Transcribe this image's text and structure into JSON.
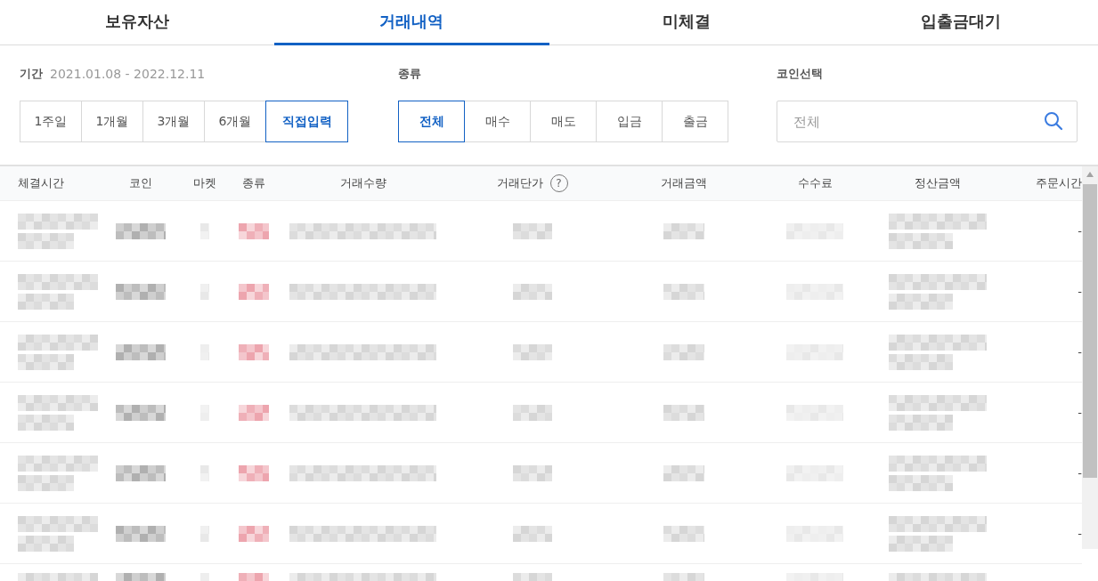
{
  "tabs": [
    {
      "label": "보유자산",
      "selected": false
    },
    {
      "label": "거래내역",
      "selected": true
    },
    {
      "label": "미체결",
      "selected": false
    },
    {
      "label": "입출금대기",
      "selected": false
    }
  ],
  "period": {
    "label": "기간",
    "range": "2021.01.08 - 2022.12.11",
    "options": [
      {
        "label": "1주일",
        "selected": false
      },
      {
        "label": "1개월",
        "selected": false
      },
      {
        "label": "3개월",
        "selected": false
      },
      {
        "label": "6개월",
        "selected": false
      },
      {
        "label": "직접입력",
        "selected": true
      }
    ]
  },
  "type_filter": {
    "label": "종류",
    "options": [
      {
        "label": "전체",
        "selected": true
      },
      {
        "label": "매수",
        "selected": false
      },
      {
        "label": "매도",
        "selected": false
      },
      {
        "label": "입금",
        "selected": false
      },
      {
        "label": "출금",
        "selected": false
      }
    ]
  },
  "coin_select": {
    "label": "코인선택",
    "placeholder": "전체"
  },
  "table": {
    "columns": [
      {
        "label": "체결시간"
      },
      {
        "label": "코인"
      },
      {
        "label": "마켓"
      },
      {
        "label": "종류"
      },
      {
        "label": "거래수량"
      },
      {
        "label": "거래단가",
        "help": "?"
      },
      {
        "label": "거래금액"
      },
      {
        "label": "수수료"
      },
      {
        "label": "정산금액"
      },
      {
        "label": "주문시간"
      }
    ],
    "rows": [
      {
        "order_time": "-"
      },
      {
        "order_time": "-"
      },
      {
        "order_time": "-"
      },
      {
        "order_time": "-"
      },
      {
        "order_time": "-"
      },
      {
        "order_time": "-"
      },
      {}
    ]
  }
}
